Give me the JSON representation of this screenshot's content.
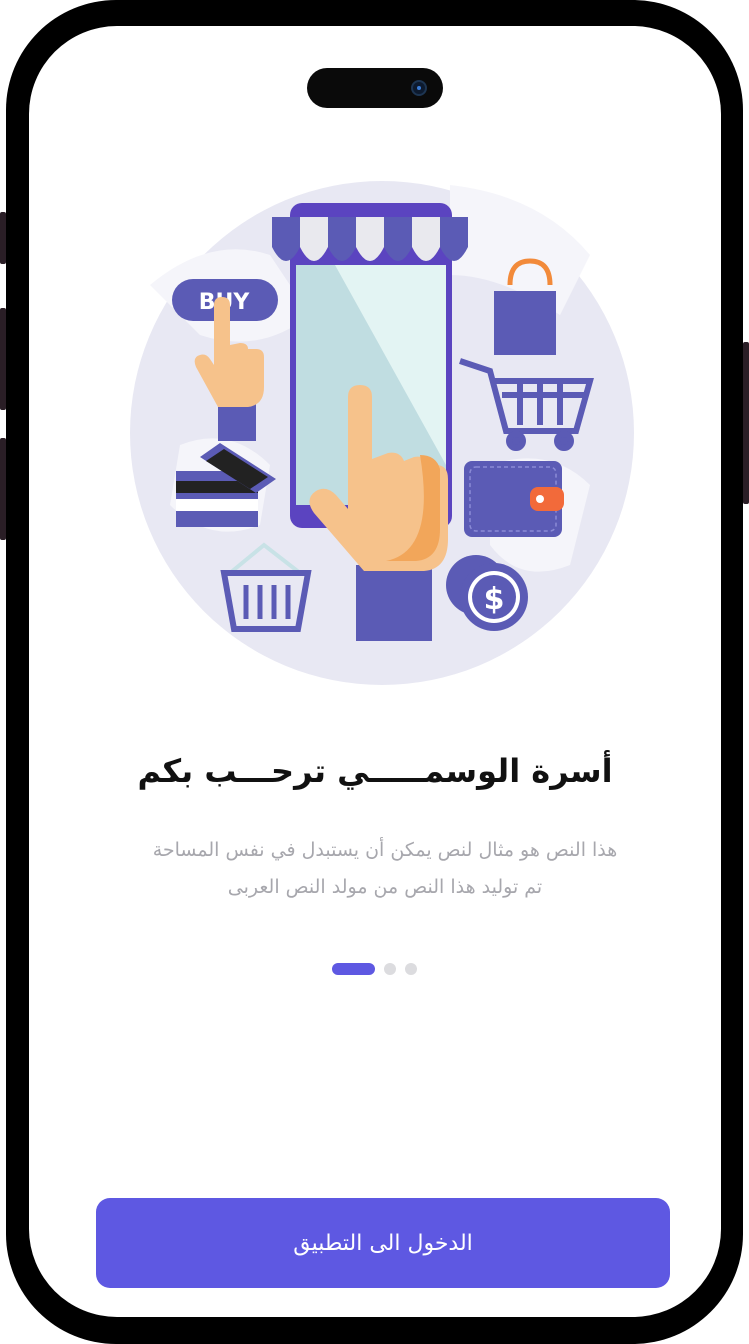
{
  "onboarding": {
    "title": "أسرة الوسمـــــي ترحـــب بكم",
    "description_line1": "هذا النص هو مثال لنص يمكن أن يستبدل في نفس المساحة",
    "description_line2": "تم توليد هذا النص من مولد النص العربى",
    "illustration_label": "BUY",
    "currency_symbol": "$",
    "page_indicator": {
      "total": 3,
      "current": 1
    }
  },
  "actions": {
    "enter_app_label": "الدخول الى التطبيق"
  },
  "colors": {
    "accent": "#5e58e2",
    "illustration_primary": "#5b5bb5",
    "illustration_bg": "#e7e7f3",
    "hand": "#f6c28b",
    "shadow_hand": "#f2a65a"
  }
}
